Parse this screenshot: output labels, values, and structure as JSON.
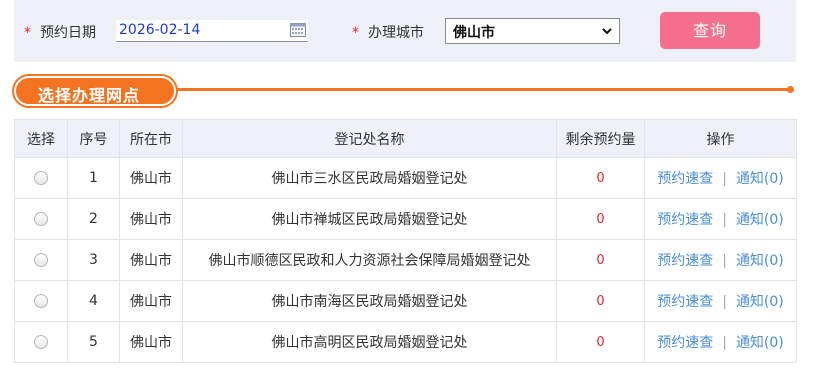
{
  "filter": {
    "date_label": "预约日期",
    "date_value": "2026-02-14",
    "city_label": "办理城市",
    "city_value": "佛山市",
    "query_label": "查询"
  },
  "section": {
    "title": "选择办理网点"
  },
  "table": {
    "headers": [
      "选择",
      "序号",
      "所在市",
      "登记处名称",
      "剩余预约量",
      "操作"
    ],
    "rows": [
      {
        "no": "1",
        "city": "佛山市",
        "name": "佛山市三水区民政局婚姻登记处",
        "remain": "0",
        "check": "预约速查",
        "sep": "|",
        "notice": "通知(0)"
      },
      {
        "no": "2",
        "city": "佛山市",
        "name": "佛山市禅城区民政局婚姻登记处",
        "remain": "0",
        "check": "预约速查",
        "sep": "|",
        "notice": "通知(0)"
      },
      {
        "no": "3",
        "city": "佛山市",
        "name": "佛山市顺德区民政和人力资源社会保障局婚姻登记处",
        "remain": "0",
        "check": "预约速查",
        "sep": "|",
        "notice": "通知(0)"
      },
      {
        "no": "4",
        "city": "佛山市",
        "name": "佛山市南海区民政局婚姻登记处",
        "remain": "0",
        "check": "预约速查",
        "sep": "|",
        "notice": "通知(0)"
      },
      {
        "no": "5",
        "city": "佛山市",
        "name": "佛山市高明区民政局婚姻登记处",
        "remain": "0",
        "check": "预约速查",
        "sep": "|",
        "notice": "通知(0)"
      }
    ]
  },
  "colors": {
    "accent_orange": "#f47321",
    "query_button": "#f4708c",
    "link_blue": "#4a8fd8",
    "required_red": "#e3262b"
  },
  "icons": {
    "date_picker": "calendar-icon",
    "select": "chevron-down-icon",
    "required": "asterisk"
  }
}
